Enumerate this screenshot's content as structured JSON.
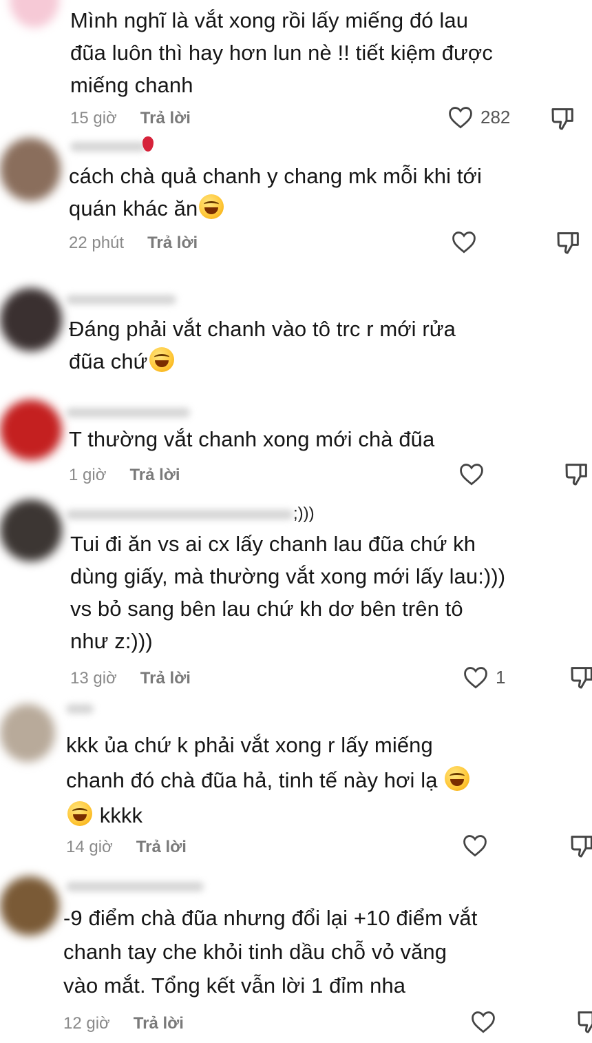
{
  "comments": [
    {
      "name_tail": "",
      "lines": [
        "Mình nghĩ là vắt xong rồi lấy miếng đó lau",
        "đũa luôn thì hay hơn lun nè !! tiết kiệm được",
        "miếng chanh"
      ],
      "time": "15 giờ",
      "reply_label": "Trả lời",
      "like_count": "282"
    },
    {
      "name_tail": "",
      "lines": [
        "cách chà quả chanh y chang mk mỗi khi tới",
        "quán khác ăn"
      ],
      "emoji_after_last": "face-with-tears-of-joy-icon",
      "time": "22 phút",
      "reply_label": "Trả lời",
      "like_count": ""
    },
    {
      "name_tail": "",
      "lines": [
        "Đáng phải vắt chanh vào tô trc r mới rửa",
        "đũa chứ"
      ],
      "emoji_after_last": "face-with-tears-of-joy-icon",
      "time": "",
      "reply_label": "",
      "like_count": ""
    },
    {
      "name_tail": "",
      "lines": [
        "T thường vắt chanh xong mới chà đũa"
      ],
      "time": "1 giờ",
      "reply_label": "Trả lời",
      "like_count": ""
    },
    {
      "name_tail": ";)))",
      "lines": [
        "Tui đi ăn vs ai cx lấy chanh lau đũa chứ kh",
        "dùng giấy, mà thường vắt xong mới lấy lau:)))",
        "vs bỏ sang bên lau chứ kh dơ bên trên tô",
        "như z:)))"
      ],
      "time": "13 giờ",
      "reply_label": "Trả lời",
      "like_count": "1"
    },
    {
      "name_tail": "",
      "lines": [
        "kkk ủa chứ k phải vắt xong r lấy miếng",
        "chanh đó chà đũa hả, tinh tế này hơi lạ",
        "kkkk"
      ],
      "time": "14 giờ",
      "reply_label": "Trả lời",
      "like_count": ""
    },
    {
      "name_tail": "",
      "lines": [
        "-9 điểm chà đũa nhưng đổi lại +10 điểm vắt",
        "chanh tay che khỏi tinh dầu chỗ vỏ văng",
        "vào mắt. Tổng kết vẫn lời 1 đỉm nha"
      ],
      "time": "12 giờ",
      "reply_label": "Trả lời",
      "like_count": ""
    }
  ],
  "icons": {
    "like": "heart-outline-icon",
    "dislike": "thumbs-down-outline-icon",
    "emoji_laugh": "face-with-tears-of-joy-icon",
    "emoji_grin": "grinning-squinting-face-icon"
  },
  "colors": {
    "text": "#161616",
    "meta": "#8a8a8a",
    "reply": "#7a7a7a",
    "icon": "#444444"
  }
}
